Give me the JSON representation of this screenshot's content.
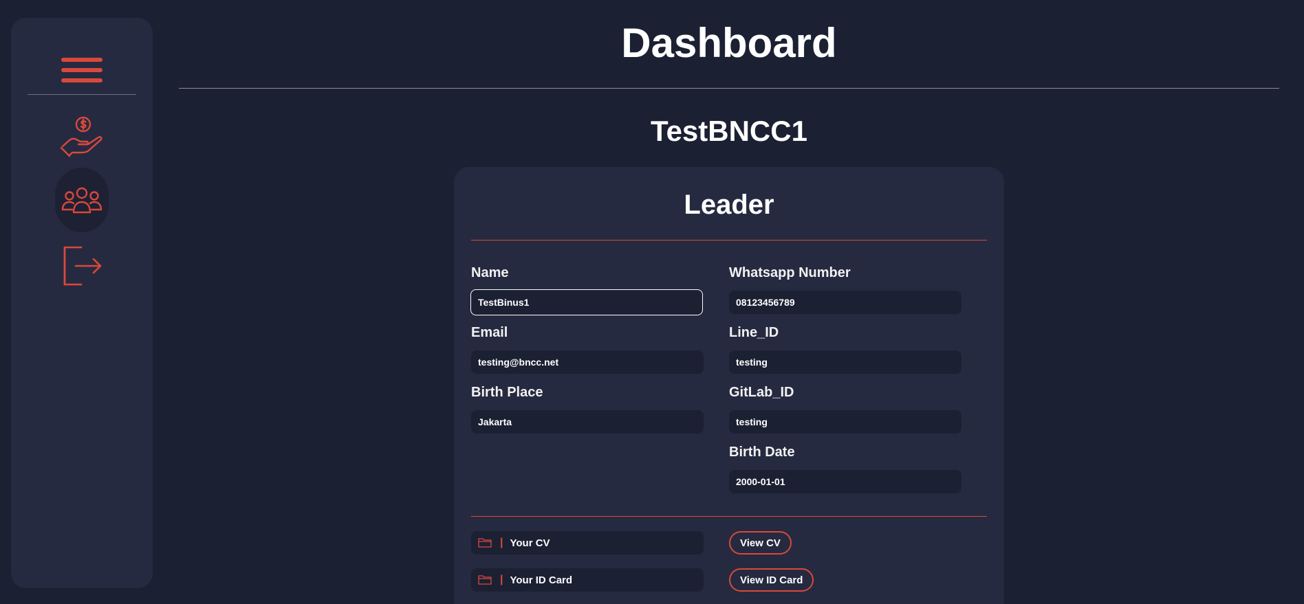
{
  "page": {
    "title": "Dashboard",
    "team_name": "TestBNCC1"
  },
  "sidebar": {
    "items": [
      {
        "icon": "menu-icon"
      },
      {
        "icon": "payment-icon"
      },
      {
        "icon": "team-icon",
        "active": true
      },
      {
        "icon": "logout-icon"
      }
    ]
  },
  "card": {
    "title": "Leader",
    "fields": {
      "name": {
        "label": "Name",
        "value": "TestBinus1"
      },
      "email": {
        "label": "Email",
        "value": "testing@bncc.net"
      },
      "birth_place": {
        "label": "Birth Place",
        "value": "Jakarta"
      },
      "whatsapp": {
        "label": "Whatsapp Number",
        "value": "08123456789"
      },
      "line_id": {
        "label": "Line_ID",
        "value": "testing"
      },
      "gitlab_id": {
        "label": "GitLab_ID",
        "value": "testing"
      },
      "birth_date": {
        "label": "Birth Date",
        "value": "2000-01-01"
      }
    },
    "files": [
      {
        "label": "Your CV",
        "button": "View CV",
        "icon": "folder-icon",
        "separator": "|"
      },
      {
        "label": "Your ID Card",
        "button": "View ID Card",
        "icon": "folder-icon",
        "separator": "|"
      }
    ]
  },
  "colors": {
    "background": "#1c2033",
    "panel": "#262a40",
    "accent": "#d9493b"
  }
}
